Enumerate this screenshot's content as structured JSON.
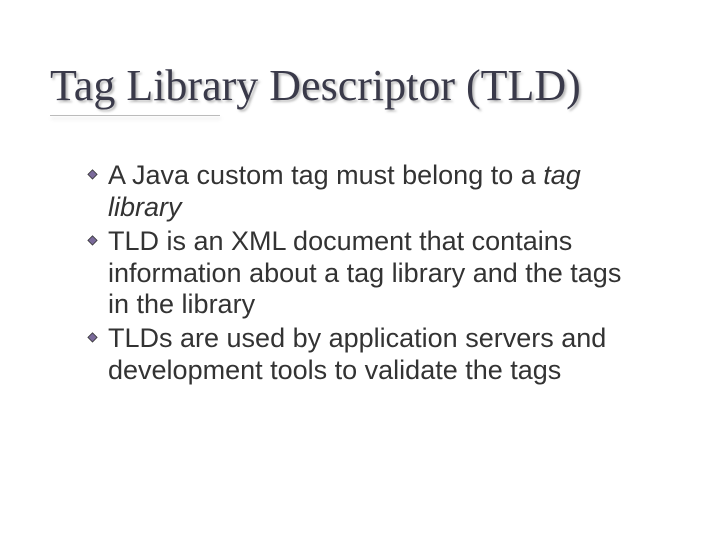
{
  "title": "Tag Library Descriptor (TLD)",
  "bullets": [
    {
      "pre": "A Java custom tag must belong to a ",
      "ital": "tag library",
      "post": ""
    },
    {
      "pre": "TLD is an XML document that contains information about a tag library and the tags in the library",
      "ital": "",
      "post": ""
    },
    {
      "pre": "TLDs are used by application servers and development tools to validate the tags",
      "ital": "",
      "post": ""
    }
  ]
}
